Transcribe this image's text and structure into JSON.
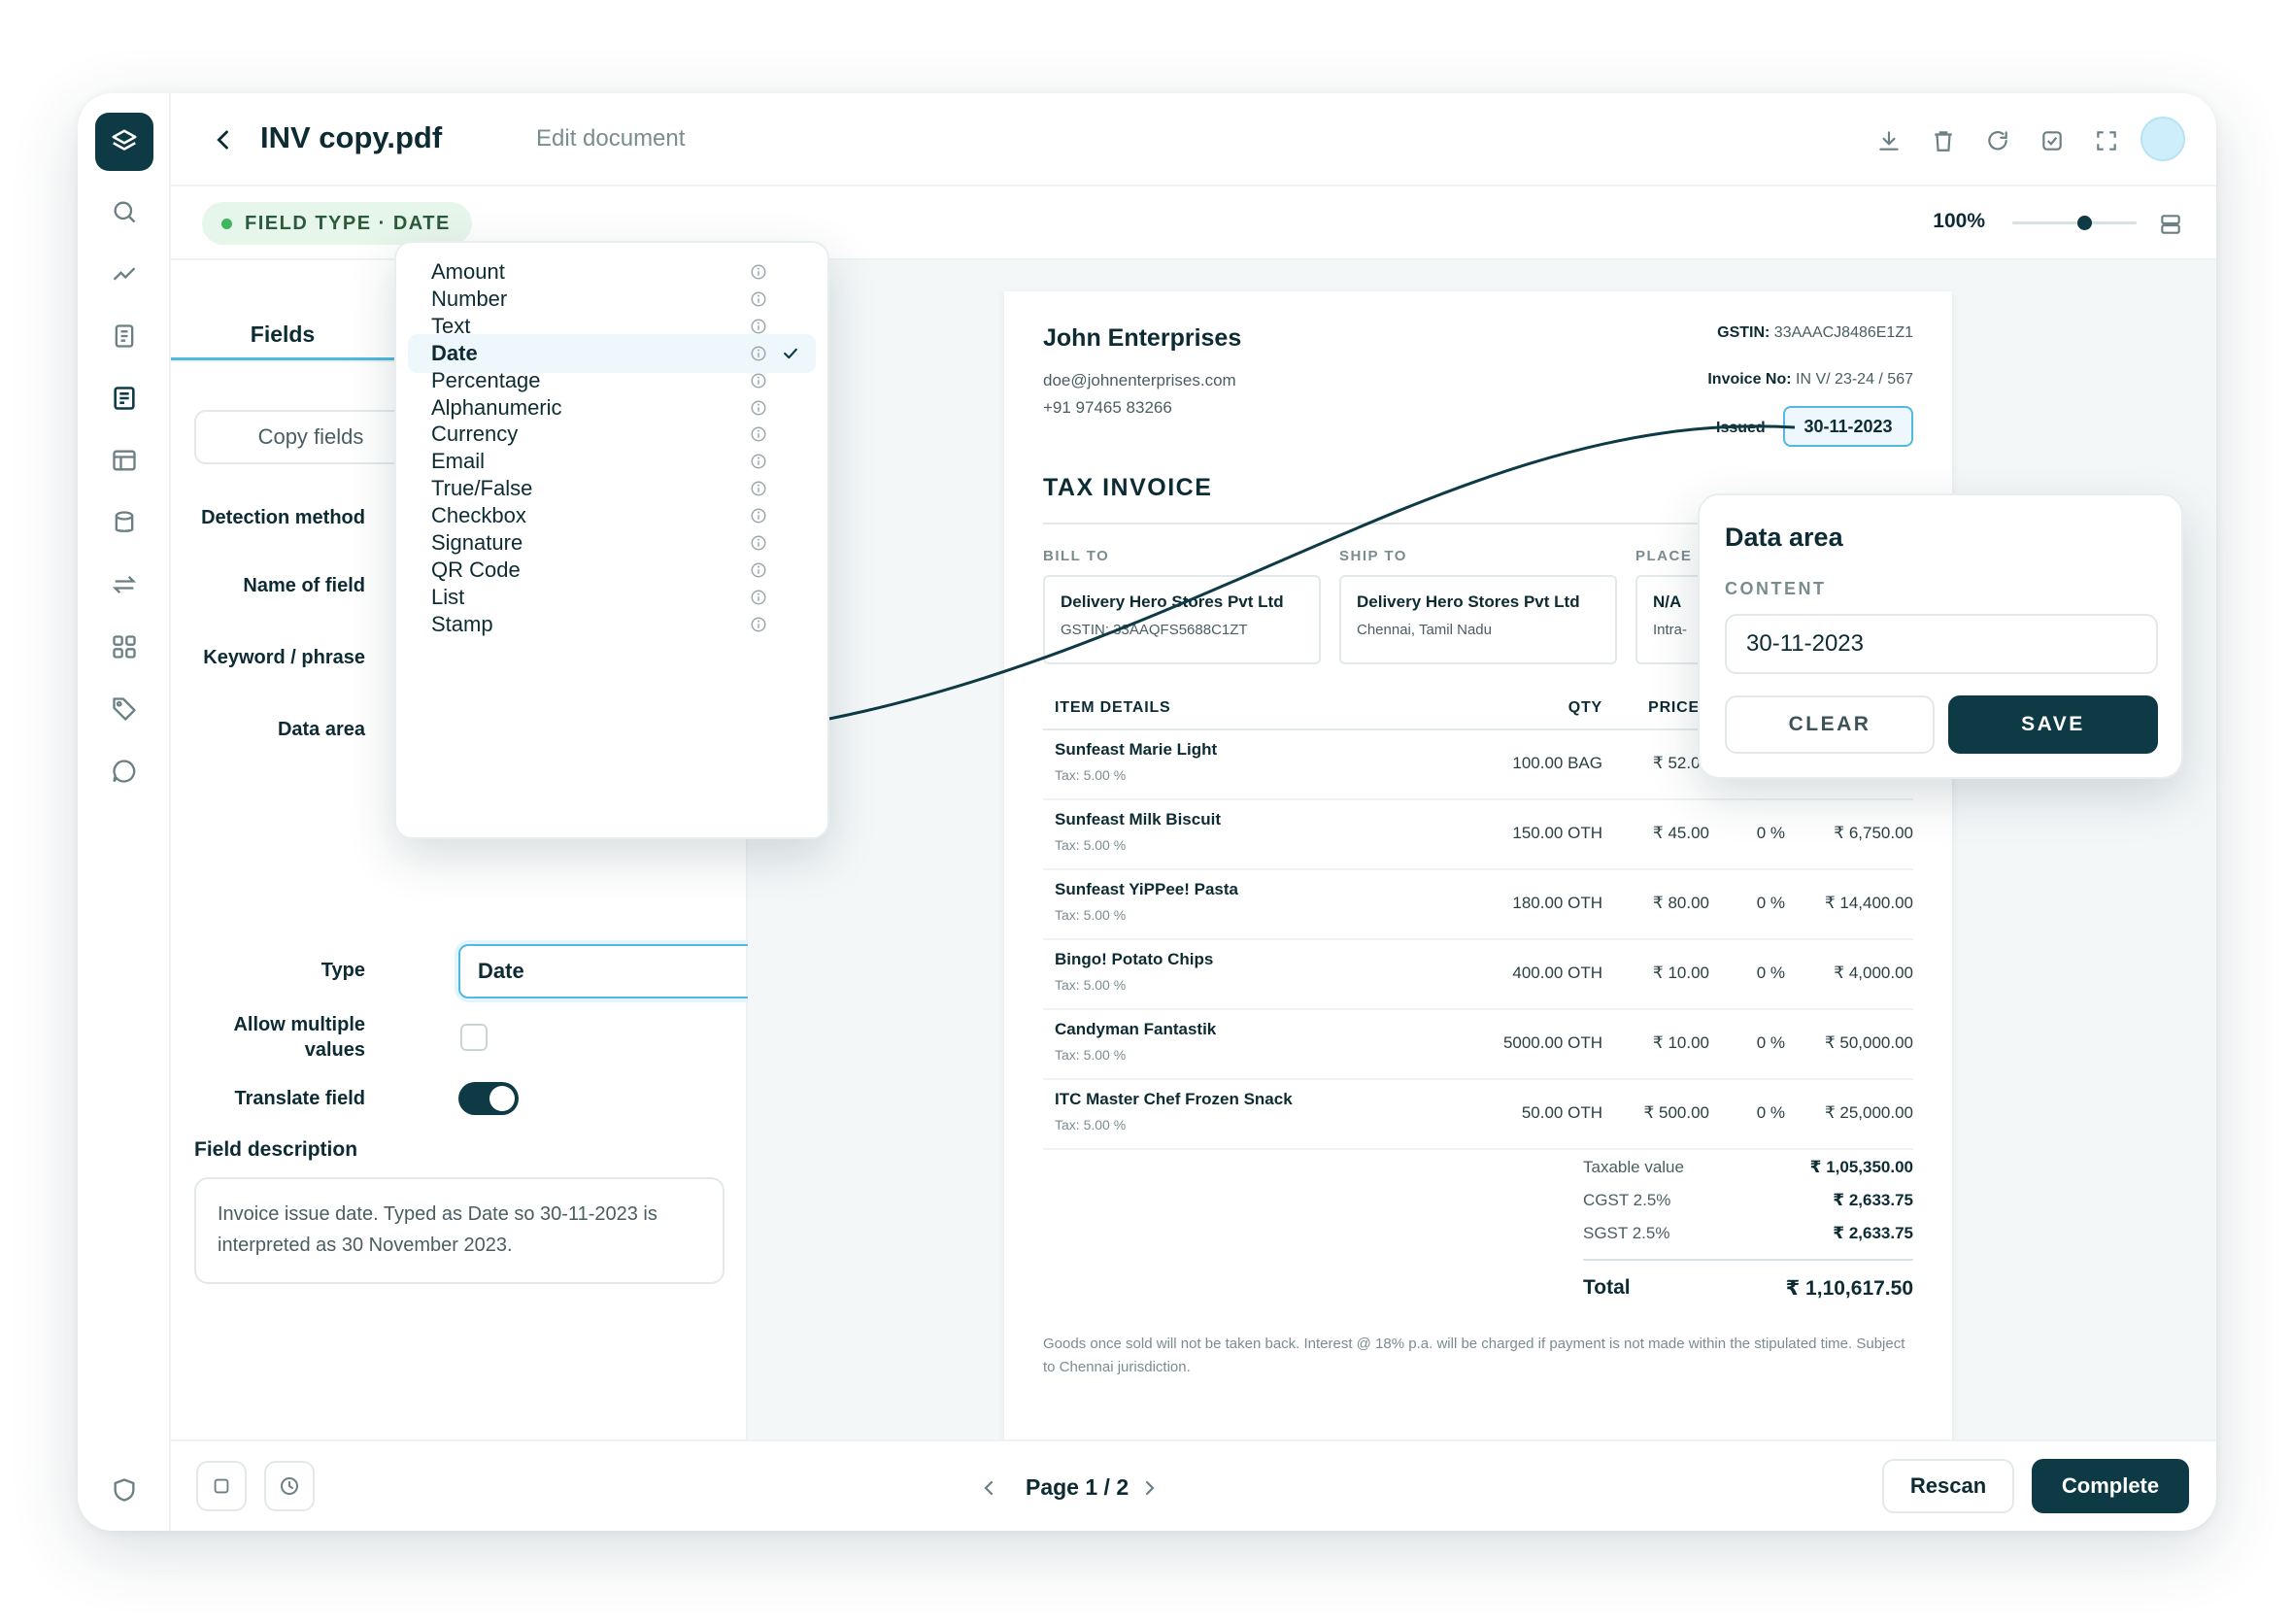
{
  "header": {
    "title": "INV copy.pdf",
    "subtitle": "Edit document",
    "icons": [
      "download-icon",
      "trash-icon",
      "refresh-icon",
      "check-square-icon",
      "fullscreen-icon"
    ]
  },
  "rail": {
    "icons": [
      "layers-icon",
      "search-icon",
      "trend-icon",
      "document-icon",
      "form-icon",
      "layout-icon",
      "database-icon",
      "swap-icon",
      "grid-icon",
      "tag-icon",
      "chat-icon",
      "shield-icon"
    ],
    "active": "form-icon"
  },
  "toolbar": {
    "field_type_pill": "FIELD TYPE · DATE",
    "zoom_label": "100%",
    "zoom_level_percent": 52
  },
  "panel": {
    "tab": "Fields",
    "copy_fields": "Copy fields",
    "labels": {
      "detection_method": "Detection method",
      "name_of_field": "Name of field",
      "keyword": "Keyword / phrase",
      "data_area": "Data area",
      "type": "Type",
      "allow_multiple": "Allow multiple values",
      "translate": "Translate field"
    },
    "type_value": "Date",
    "allow_multiple_checked": false,
    "translate_on": true,
    "description_title": "Field description",
    "description": "Invoice issue date. Typed as Date so 30-11-2023 is interpreted as 30 November 2023."
  },
  "dropdown": {
    "options": [
      "Amount",
      "Number",
      "Text",
      "Date",
      "Percentage",
      "Alphanumeric",
      "Currency",
      "Email",
      "True/False",
      "Checkbox",
      "Signature",
      "QR Code",
      "List",
      "Stamp"
    ],
    "selected": "Date"
  },
  "invoice": {
    "company": "John Enterprises",
    "email": "doe@johnenterprises.com",
    "phone": "+91 97465 83266",
    "gstin_label": "GSTIN:",
    "gstin": "33AAACJ8486E1Z1",
    "invoice_no_label": "Invoice No:",
    "invoice_no": "IN V/ 23-24 / 567",
    "issued_label": "Issued",
    "issued": "30-11-2023",
    "title": "TAX INVOICE",
    "bill_to_label": "BILL TO",
    "ship_to_label": "SHIP TO",
    "place_label": "PLACE",
    "bill_to": {
      "name": "Delivery Hero Stores Pvt Ltd",
      "detail": "GSTIN: 33AAQFS5688C1ZT"
    },
    "ship_to": {
      "name": "Delivery Hero Stores Pvt Ltd",
      "detail": "Chennai, Tamil Nadu"
    },
    "place": {
      "name": "N/A",
      "detail": "Intra-"
    },
    "columns": {
      "item": "ITEM DETAILS",
      "qty": "QTY",
      "price": "PRICE"
    },
    "rows": [
      {
        "name": "Sunfeast Marie Light",
        "tax": "Tax: 5.00 %",
        "qty": "100.00 BAG",
        "price": "₹ 52.00",
        "disc": "",
        "amount": ""
      },
      {
        "name": "Sunfeast Milk Biscuit",
        "tax": "Tax: 5.00 %",
        "qty": "150.00 OTH",
        "price": "₹ 45.00",
        "disc": "0 %",
        "amount": "₹ 6,750.00"
      },
      {
        "name": "Sunfeast YiPPee! Pasta",
        "tax": "Tax: 5.00 %",
        "qty": "180.00 OTH",
        "price": "₹ 80.00",
        "disc": "0 %",
        "amount": "₹ 14,400.00"
      },
      {
        "name": "Bingo! Potato Chips",
        "tax": "Tax: 5.00 %",
        "qty": "400.00 OTH",
        "price": "₹ 10.00",
        "disc": "0 %",
        "amount": "₹ 4,000.00"
      },
      {
        "name": "Candyman Fantastik",
        "tax": "Tax: 5.00 %",
        "qty": "5000.00 OTH",
        "price": "₹ 10.00",
        "disc": "0 %",
        "amount": "₹ 50,000.00"
      },
      {
        "name": "ITC Master Chef Frozen Snack",
        "tax": "Tax: 5.00 %",
        "qty": "50.00 OTH",
        "price": "₹ 500.00",
        "disc": "0 %",
        "amount": "₹ 25,000.00"
      }
    ],
    "totals": [
      {
        "label": "Taxable value",
        "value": "₹ 1,05,350.00"
      },
      {
        "label": "CGST 2.5%",
        "value": "₹ 2,633.75"
      },
      {
        "label": "SGST 2.5%",
        "value": "₹ 2,633.75"
      }
    ],
    "grand_label": "Total",
    "grand_value": "₹ 1,10,617.50",
    "footnote": "Goods once sold will not be taken back. Interest @ 18% p.a. will be charged if payment is not made within the stipulated time. Subject to Chennai jurisdiction."
  },
  "popover": {
    "title": "Data area",
    "content_label": "CONTENT",
    "content_value": "30-11-2023",
    "clear": "CLEAR",
    "save": "SAVE"
  },
  "footer": {
    "page": "Page 1 / 2",
    "rescan": "Rescan",
    "complete": "Complete"
  },
  "colors": {
    "primary": "#0d3a45",
    "accent": "#51b8de",
    "pill_bg": "#e7f6ea",
    "pill_dot": "#3fb560"
  }
}
